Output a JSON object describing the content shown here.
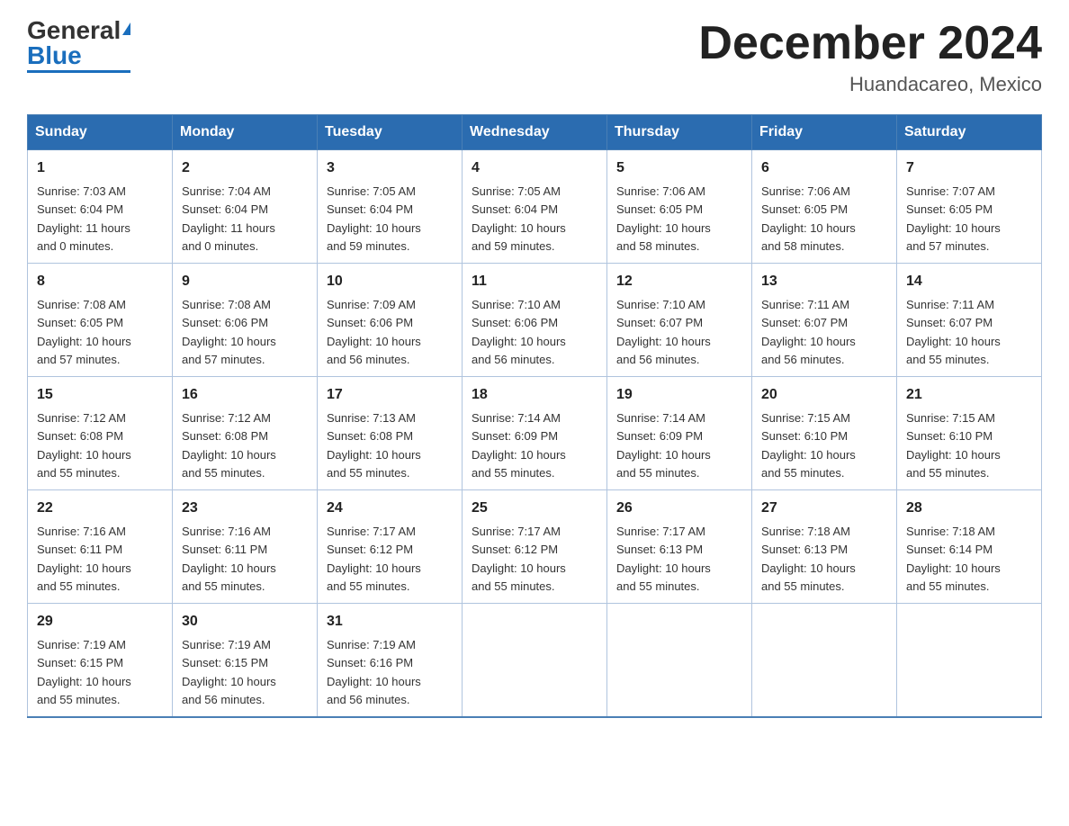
{
  "header": {
    "logo": {
      "text_general": "General",
      "text_blue": "Blue"
    },
    "title": "December 2024",
    "location": "Huandacareo, Mexico"
  },
  "days_of_week": [
    "Sunday",
    "Monday",
    "Tuesday",
    "Wednesday",
    "Thursday",
    "Friday",
    "Saturday"
  ],
  "weeks": [
    [
      {
        "day": "1",
        "sunrise": "7:03 AM",
        "sunset": "6:04 PM",
        "daylight": "11 hours and 0 minutes."
      },
      {
        "day": "2",
        "sunrise": "7:04 AM",
        "sunset": "6:04 PM",
        "daylight": "11 hours and 0 minutes."
      },
      {
        "day": "3",
        "sunrise": "7:05 AM",
        "sunset": "6:04 PM",
        "daylight": "10 hours and 59 minutes."
      },
      {
        "day": "4",
        "sunrise": "7:05 AM",
        "sunset": "6:04 PM",
        "daylight": "10 hours and 59 minutes."
      },
      {
        "day": "5",
        "sunrise": "7:06 AM",
        "sunset": "6:05 PM",
        "daylight": "10 hours and 58 minutes."
      },
      {
        "day": "6",
        "sunrise": "7:06 AM",
        "sunset": "6:05 PM",
        "daylight": "10 hours and 58 minutes."
      },
      {
        "day": "7",
        "sunrise": "7:07 AM",
        "sunset": "6:05 PM",
        "daylight": "10 hours and 57 minutes."
      }
    ],
    [
      {
        "day": "8",
        "sunrise": "7:08 AM",
        "sunset": "6:05 PM",
        "daylight": "10 hours and 57 minutes."
      },
      {
        "day": "9",
        "sunrise": "7:08 AM",
        "sunset": "6:06 PM",
        "daylight": "10 hours and 57 minutes."
      },
      {
        "day": "10",
        "sunrise": "7:09 AM",
        "sunset": "6:06 PM",
        "daylight": "10 hours and 56 minutes."
      },
      {
        "day": "11",
        "sunrise": "7:10 AM",
        "sunset": "6:06 PM",
        "daylight": "10 hours and 56 minutes."
      },
      {
        "day": "12",
        "sunrise": "7:10 AM",
        "sunset": "6:07 PM",
        "daylight": "10 hours and 56 minutes."
      },
      {
        "day": "13",
        "sunrise": "7:11 AM",
        "sunset": "6:07 PM",
        "daylight": "10 hours and 56 minutes."
      },
      {
        "day": "14",
        "sunrise": "7:11 AM",
        "sunset": "6:07 PM",
        "daylight": "10 hours and 55 minutes."
      }
    ],
    [
      {
        "day": "15",
        "sunrise": "7:12 AM",
        "sunset": "6:08 PM",
        "daylight": "10 hours and 55 minutes."
      },
      {
        "day": "16",
        "sunrise": "7:12 AM",
        "sunset": "6:08 PM",
        "daylight": "10 hours and 55 minutes."
      },
      {
        "day": "17",
        "sunrise": "7:13 AM",
        "sunset": "6:08 PM",
        "daylight": "10 hours and 55 minutes."
      },
      {
        "day": "18",
        "sunrise": "7:14 AM",
        "sunset": "6:09 PM",
        "daylight": "10 hours and 55 minutes."
      },
      {
        "day": "19",
        "sunrise": "7:14 AM",
        "sunset": "6:09 PM",
        "daylight": "10 hours and 55 minutes."
      },
      {
        "day": "20",
        "sunrise": "7:15 AM",
        "sunset": "6:10 PM",
        "daylight": "10 hours and 55 minutes."
      },
      {
        "day": "21",
        "sunrise": "7:15 AM",
        "sunset": "6:10 PM",
        "daylight": "10 hours and 55 minutes."
      }
    ],
    [
      {
        "day": "22",
        "sunrise": "7:16 AM",
        "sunset": "6:11 PM",
        "daylight": "10 hours and 55 minutes."
      },
      {
        "day": "23",
        "sunrise": "7:16 AM",
        "sunset": "6:11 PM",
        "daylight": "10 hours and 55 minutes."
      },
      {
        "day": "24",
        "sunrise": "7:17 AM",
        "sunset": "6:12 PM",
        "daylight": "10 hours and 55 minutes."
      },
      {
        "day": "25",
        "sunrise": "7:17 AM",
        "sunset": "6:12 PM",
        "daylight": "10 hours and 55 minutes."
      },
      {
        "day": "26",
        "sunrise": "7:17 AM",
        "sunset": "6:13 PM",
        "daylight": "10 hours and 55 minutes."
      },
      {
        "day": "27",
        "sunrise": "7:18 AM",
        "sunset": "6:13 PM",
        "daylight": "10 hours and 55 minutes."
      },
      {
        "day": "28",
        "sunrise": "7:18 AM",
        "sunset": "6:14 PM",
        "daylight": "10 hours and 55 minutes."
      }
    ],
    [
      {
        "day": "29",
        "sunrise": "7:19 AM",
        "sunset": "6:15 PM",
        "daylight": "10 hours and 55 minutes."
      },
      {
        "day": "30",
        "sunrise": "7:19 AM",
        "sunset": "6:15 PM",
        "daylight": "10 hours and 56 minutes."
      },
      {
        "day": "31",
        "sunrise": "7:19 AM",
        "sunset": "6:16 PM",
        "daylight": "10 hours and 56 minutes."
      },
      null,
      null,
      null,
      null
    ]
  ],
  "labels": {
    "sunrise": "Sunrise:",
    "sunset": "Sunset:",
    "daylight": "Daylight:"
  }
}
